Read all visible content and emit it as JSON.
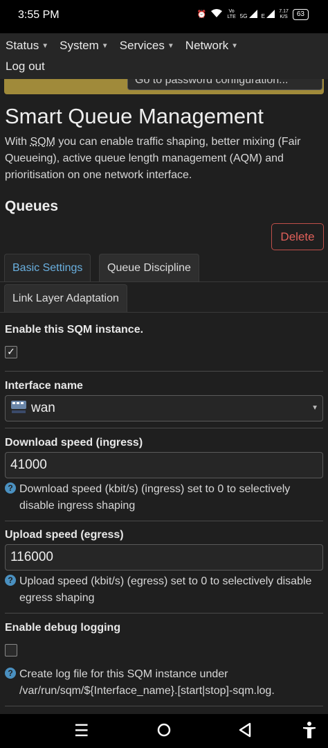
{
  "status_bar": {
    "time": "3:55 PM",
    "volte": "Vo\nLTE",
    "network_5g": "5G",
    "network_e": "E",
    "speed_value": "7.17",
    "speed_unit": "K/S",
    "battery": "63"
  },
  "nav": {
    "items": [
      {
        "label": "Status"
      },
      {
        "label": "System"
      },
      {
        "label": "Services"
      },
      {
        "label": "Network"
      }
    ],
    "logout": "Log out"
  },
  "warning": {
    "button_label": "Go to password configuration..."
  },
  "page": {
    "title": "Smart Queue Management",
    "desc_pre": "With ",
    "desc_abbr": "SQM",
    "desc_post": " you can enable traffic shaping, better mixing (Fair Queueing), active queue length management (AQM) and prioritisation on one network interface.",
    "section": "Queues",
    "delete_label": "Delete"
  },
  "tabs": [
    {
      "label": "Basic Settings",
      "active": true
    },
    {
      "label": "Queue Discipline",
      "active": false
    },
    {
      "label": "Link Layer Adaptation",
      "active": false
    }
  ],
  "form": {
    "enable": {
      "label": "Enable this SQM instance.",
      "checked": true
    },
    "interface": {
      "label": "Interface name",
      "value": "wan"
    },
    "download": {
      "label": "Download speed (ingress)",
      "value": "41000",
      "hint": "Download speed (kbit/s) (ingress) set to 0 to selectively disable ingress shaping"
    },
    "upload": {
      "label": "Upload speed (egress)",
      "value": "116000",
      "hint": "Upload speed (kbit/s) (egress) set to 0 to selectively disable egress shaping"
    },
    "debug": {
      "label": "Enable debug logging",
      "checked": false,
      "hint": "Create log file for this SQM instance under /var/run/sqm/${Interface_name}.[start|stop]-sqm.log."
    }
  },
  "colors": {
    "accent": "#6ab0e0",
    "danger": "#e0605a",
    "warning": "#a08a3a",
    "background": "#1f1f1f"
  }
}
